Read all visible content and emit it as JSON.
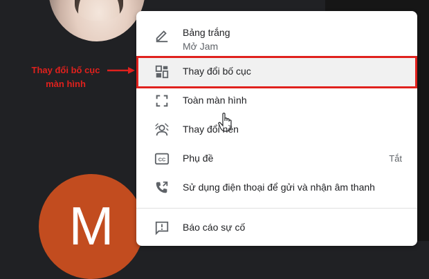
{
  "annotation": {
    "line1": "Thay đổi bố cục",
    "line2": "màn hình"
  },
  "avatar": {
    "initial": "M"
  },
  "menu": {
    "whiteboard": {
      "label": "Bảng trắng",
      "sub": "Mở Jam",
      "icon": "pen-icon"
    },
    "layout": {
      "label": "Thay đổi bố cục",
      "icon": "layout-icon"
    },
    "fullscreen": {
      "label": "Toàn màn hình",
      "icon": "fullscreen-icon"
    },
    "background": {
      "label": "Thay đổi nền",
      "icon": "background-icon"
    },
    "captions": {
      "label": "Phụ đề",
      "status": "Tắt",
      "icon": "cc-icon"
    },
    "phone": {
      "label": "Sử dụng điện thoại để gửi và nhận âm thanh",
      "icon": "phone-forward-icon"
    },
    "report": {
      "label": "Báo cáo sự cố",
      "icon": "report-icon"
    }
  },
  "colors": {
    "highlight": "#e0211d",
    "avatar_bg": "#c24c1f",
    "background": "#202124"
  }
}
